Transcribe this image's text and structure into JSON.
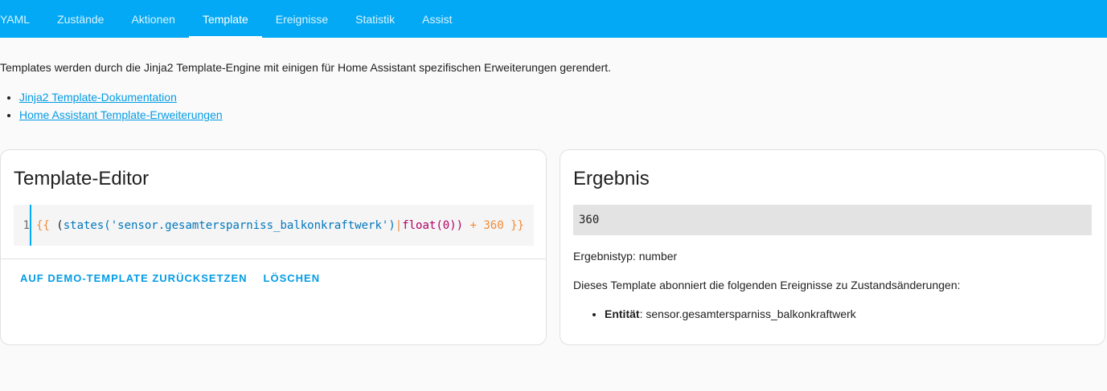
{
  "tabs": [
    {
      "label": "YAML",
      "active": false
    },
    {
      "label": "Zustände",
      "active": false
    },
    {
      "label": "Aktionen",
      "active": false
    },
    {
      "label": "Template",
      "active": true
    },
    {
      "label": "Ereignisse",
      "active": false
    },
    {
      "label": "Statistik",
      "active": false
    },
    {
      "label": "Assist",
      "active": false
    }
  ],
  "intro": "Templates werden durch die Jinja2 Template-Engine mit einigen für Home Assistant spezifischen Erweiterungen gerendert.",
  "links": [
    "Jinja2 Template-Dokumentation",
    "Home Assistant Template-Erweiterungen"
  ],
  "editor": {
    "title": "Template-Editor",
    "line_number": "1",
    "code": {
      "open": "{{",
      "paren_open": " (",
      "fn": "states(",
      "str": "'sensor.gesamtersparniss_balkonkraftwerk'",
      "fn_close": ")",
      "pipe": "|",
      "filter": "float(",
      "num": "0",
      "filter_close": "))",
      "op": " + ",
      "num2": "360",
      "close": " }}"
    },
    "reset_label": "AUF DEMO-TEMPLATE ZURÜCKSETZEN",
    "clear_label": "LÖSCHEN"
  },
  "result": {
    "title": "Ergebnis",
    "value": "360",
    "type_text": "Ergebnistyp: number",
    "desc": "Dieses Template abonniert die folgenden Ereignisse zu Zustandsänderungen:",
    "entity_label": "Entität",
    "entity_value": ": sensor.gesamtersparniss_balkonkraftwerk"
  },
  "colors": {
    "header": "#03a9f4",
    "link": "#039be5",
    "result_bg": "#e3e3e3"
  }
}
